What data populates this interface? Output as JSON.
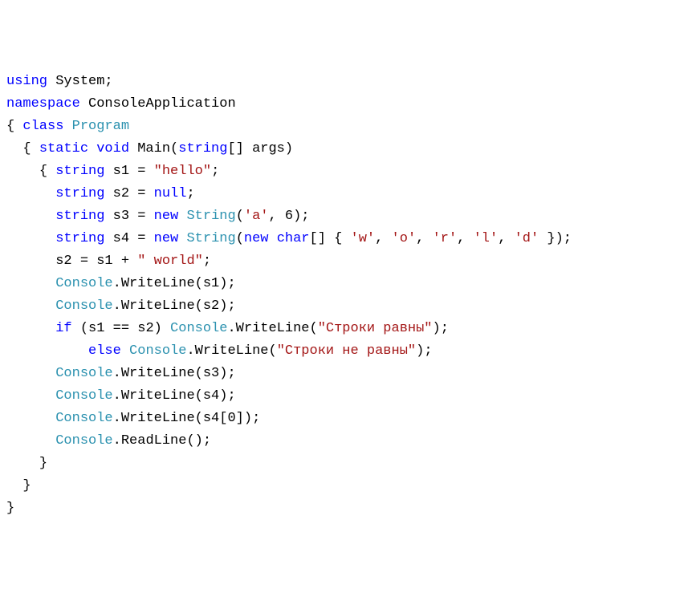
{
  "lines": [
    {
      "indent": 0,
      "tokens": [
        {
          "t": "using ",
          "c": "kw"
        },
        {
          "t": "System;",
          "c": ""
        }
      ]
    },
    {
      "indent": 0,
      "tokens": [
        {
          "t": "namespace ",
          "c": "kw"
        },
        {
          "t": "ConsoleApplication",
          "c": ""
        }
      ]
    },
    {
      "indent": 0,
      "tokens": [
        {
          "t": "{ ",
          "c": ""
        },
        {
          "t": "class ",
          "c": "kw"
        },
        {
          "t": "Program",
          "c": "type"
        }
      ]
    },
    {
      "indent": 1,
      "tokens": [
        {
          "t": "{ ",
          "c": ""
        },
        {
          "t": "static void ",
          "c": "kw"
        },
        {
          "t": "Main(",
          "c": ""
        },
        {
          "t": "string",
          "c": "kw"
        },
        {
          "t": "[] args)",
          "c": ""
        }
      ]
    },
    {
      "indent": 2,
      "tokens": [
        {
          "t": "{ ",
          "c": ""
        },
        {
          "t": "string ",
          "c": "kw"
        },
        {
          "t": "s1 = ",
          "c": ""
        },
        {
          "t": "\"hello\"",
          "c": "str"
        },
        {
          "t": ";",
          "c": ""
        }
      ]
    },
    {
      "indent": 3,
      "tokens": [
        {
          "t": "string ",
          "c": "kw"
        },
        {
          "t": "s2 = ",
          "c": ""
        },
        {
          "t": "null",
          "c": "kw"
        },
        {
          "t": ";",
          "c": ""
        }
      ]
    },
    {
      "indent": 3,
      "tokens": [
        {
          "t": "string ",
          "c": "kw"
        },
        {
          "t": "s3 = ",
          "c": ""
        },
        {
          "t": "new ",
          "c": "kw"
        },
        {
          "t": "String",
          "c": "type"
        },
        {
          "t": "(",
          "c": ""
        },
        {
          "t": "'a'",
          "c": "str"
        },
        {
          "t": ", 6);",
          "c": ""
        }
      ]
    },
    {
      "indent": 3,
      "tokens": [
        {
          "t": "string ",
          "c": "kw"
        },
        {
          "t": "s4 = ",
          "c": ""
        },
        {
          "t": "new ",
          "c": "kw"
        },
        {
          "t": "String",
          "c": "type"
        },
        {
          "t": "(",
          "c": ""
        },
        {
          "t": "new char",
          "c": "kw"
        },
        {
          "t": "[] { ",
          "c": ""
        },
        {
          "t": "'w'",
          "c": "str"
        },
        {
          "t": ", ",
          "c": ""
        },
        {
          "t": "'o'",
          "c": "str"
        },
        {
          "t": ", ",
          "c": ""
        },
        {
          "t": "'r'",
          "c": "str"
        },
        {
          "t": ", ",
          "c": ""
        },
        {
          "t": "'l'",
          "c": "str"
        },
        {
          "t": ", ",
          "c": ""
        },
        {
          "t": "'d'",
          "c": "str"
        },
        {
          "t": " });",
          "c": ""
        }
      ]
    },
    {
      "indent": 3,
      "tokens": [
        {
          "t": "s2 = s1 + ",
          "c": ""
        },
        {
          "t": "\" world\"",
          "c": "str"
        },
        {
          "t": ";",
          "c": ""
        }
      ]
    },
    {
      "indent": 3,
      "tokens": [
        {
          "t": "Console",
          "c": "type"
        },
        {
          "t": ".WriteLine(s1);",
          "c": ""
        }
      ]
    },
    {
      "indent": 3,
      "tokens": [
        {
          "t": "Console",
          "c": "type"
        },
        {
          "t": ".WriteLine(s2);",
          "c": ""
        }
      ]
    },
    {
      "indent": 3,
      "tokens": [
        {
          "t": "if ",
          "c": "kw"
        },
        {
          "t": "(s1 == s2) ",
          "c": ""
        },
        {
          "t": "Console",
          "c": "type"
        },
        {
          "t": ".WriteLine(",
          "c": ""
        },
        {
          "t": "\"Строки равны\"",
          "c": "str"
        },
        {
          "t": ");",
          "c": ""
        }
      ]
    },
    {
      "indent": 5,
      "tokens": [
        {
          "t": "else ",
          "c": "kw"
        },
        {
          "t": "Console",
          "c": "type"
        },
        {
          "t": ".WriteLine(",
          "c": ""
        },
        {
          "t": "\"Строки не равны\"",
          "c": "str"
        },
        {
          "t": ");",
          "c": ""
        }
      ]
    },
    {
      "indent": 3,
      "tokens": [
        {
          "t": "Console",
          "c": "type"
        },
        {
          "t": ".WriteLine(s3);",
          "c": ""
        }
      ]
    },
    {
      "indent": 3,
      "tokens": [
        {
          "t": "Console",
          "c": "type"
        },
        {
          "t": ".WriteLine(s4);",
          "c": ""
        }
      ]
    },
    {
      "indent": 3,
      "tokens": [
        {
          "t": "Console",
          "c": "type"
        },
        {
          "t": ".WriteLine(s4[0]);",
          "c": ""
        }
      ]
    },
    {
      "indent": 3,
      "tokens": [
        {
          "t": "Console",
          "c": "type"
        },
        {
          "t": ".ReadLine();",
          "c": ""
        }
      ]
    },
    {
      "indent": 2,
      "tokens": [
        {
          "t": "}",
          "c": ""
        }
      ]
    },
    {
      "indent": 1,
      "tokens": [
        {
          "t": "}",
          "c": ""
        }
      ]
    },
    {
      "indent": 0,
      "tokens": [
        {
          "t": "}",
          "c": ""
        }
      ]
    }
  ]
}
